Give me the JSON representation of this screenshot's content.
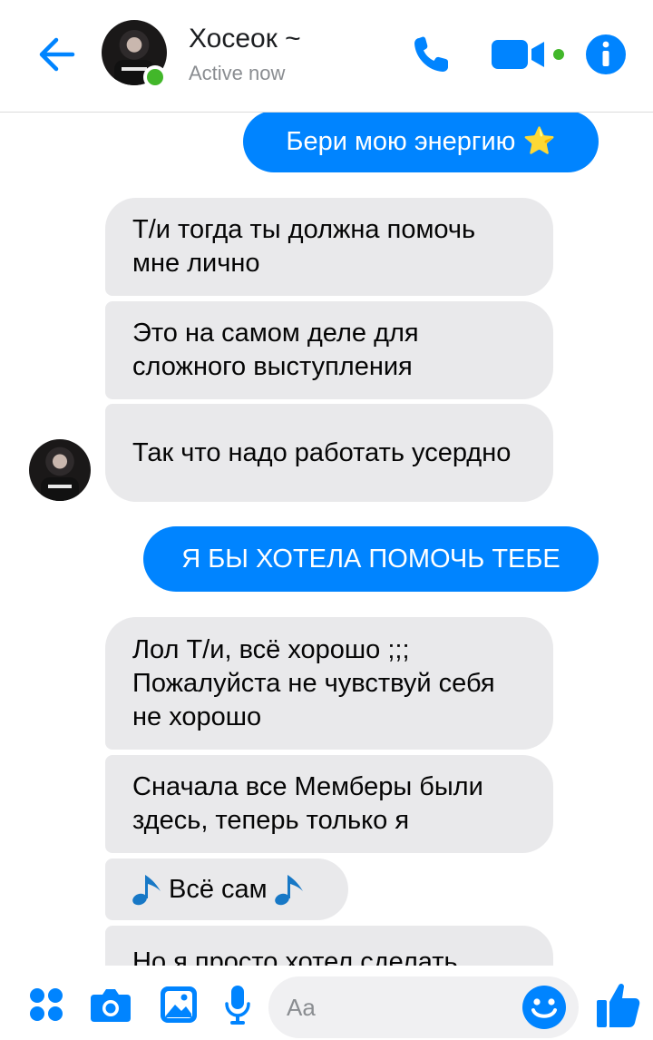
{
  "header": {
    "contact_name": "Хосеок ~",
    "status": "Active now"
  },
  "messages": [
    {
      "side": "out",
      "text": "Бери мою энергию ⭐"
    },
    {
      "side": "in",
      "text": "Т/и тогда ты должна помочь мне лично"
    },
    {
      "side": "in",
      "text": "Это на самом деле для сложного выступления"
    },
    {
      "side": "in",
      "text": "Так что надо работать усердно"
    },
    {
      "side": "out",
      "text": "Я БЫ ХОТЕЛА ПОМОЧЬ ТЕБЕ"
    },
    {
      "side": "in",
      "text": "Лол Т/и, всё хорошо ;;; Пожалуйста не чувствуй себя не хорошо"
    },
    {
      "side": "in",
      "text": "Сначала все Мемберы были здесь, теперь только я"
    },
    {
      "side": "in",
      "text": "Всё сам"
    },
    {
      "side": "in",
      "text": "Но я просто хотел сделать"
    }
  ],
  "composer": {
    "placeholder": "Aa"
  },
  "icons": {
    "back": "arrow-left-icon",
    "call": "phone-icon",
    "video": "video-camera-icon",
    "info": "info-icon",
    "apps": "four-dots-icon",
    "camera": "camera-icon",
    "gallery": "image-icon",
    "mic": "microphone-icon",
    "emoji": "smiley-icon",
    "like": "thumbs-up-icon",
    "note": "music-note-icon"
  },
  "colors": {
    "accent": "#0084ff",
    "online": "#42b72a",
    "incoming_bubble": "#e9e9eb"
  }
}
